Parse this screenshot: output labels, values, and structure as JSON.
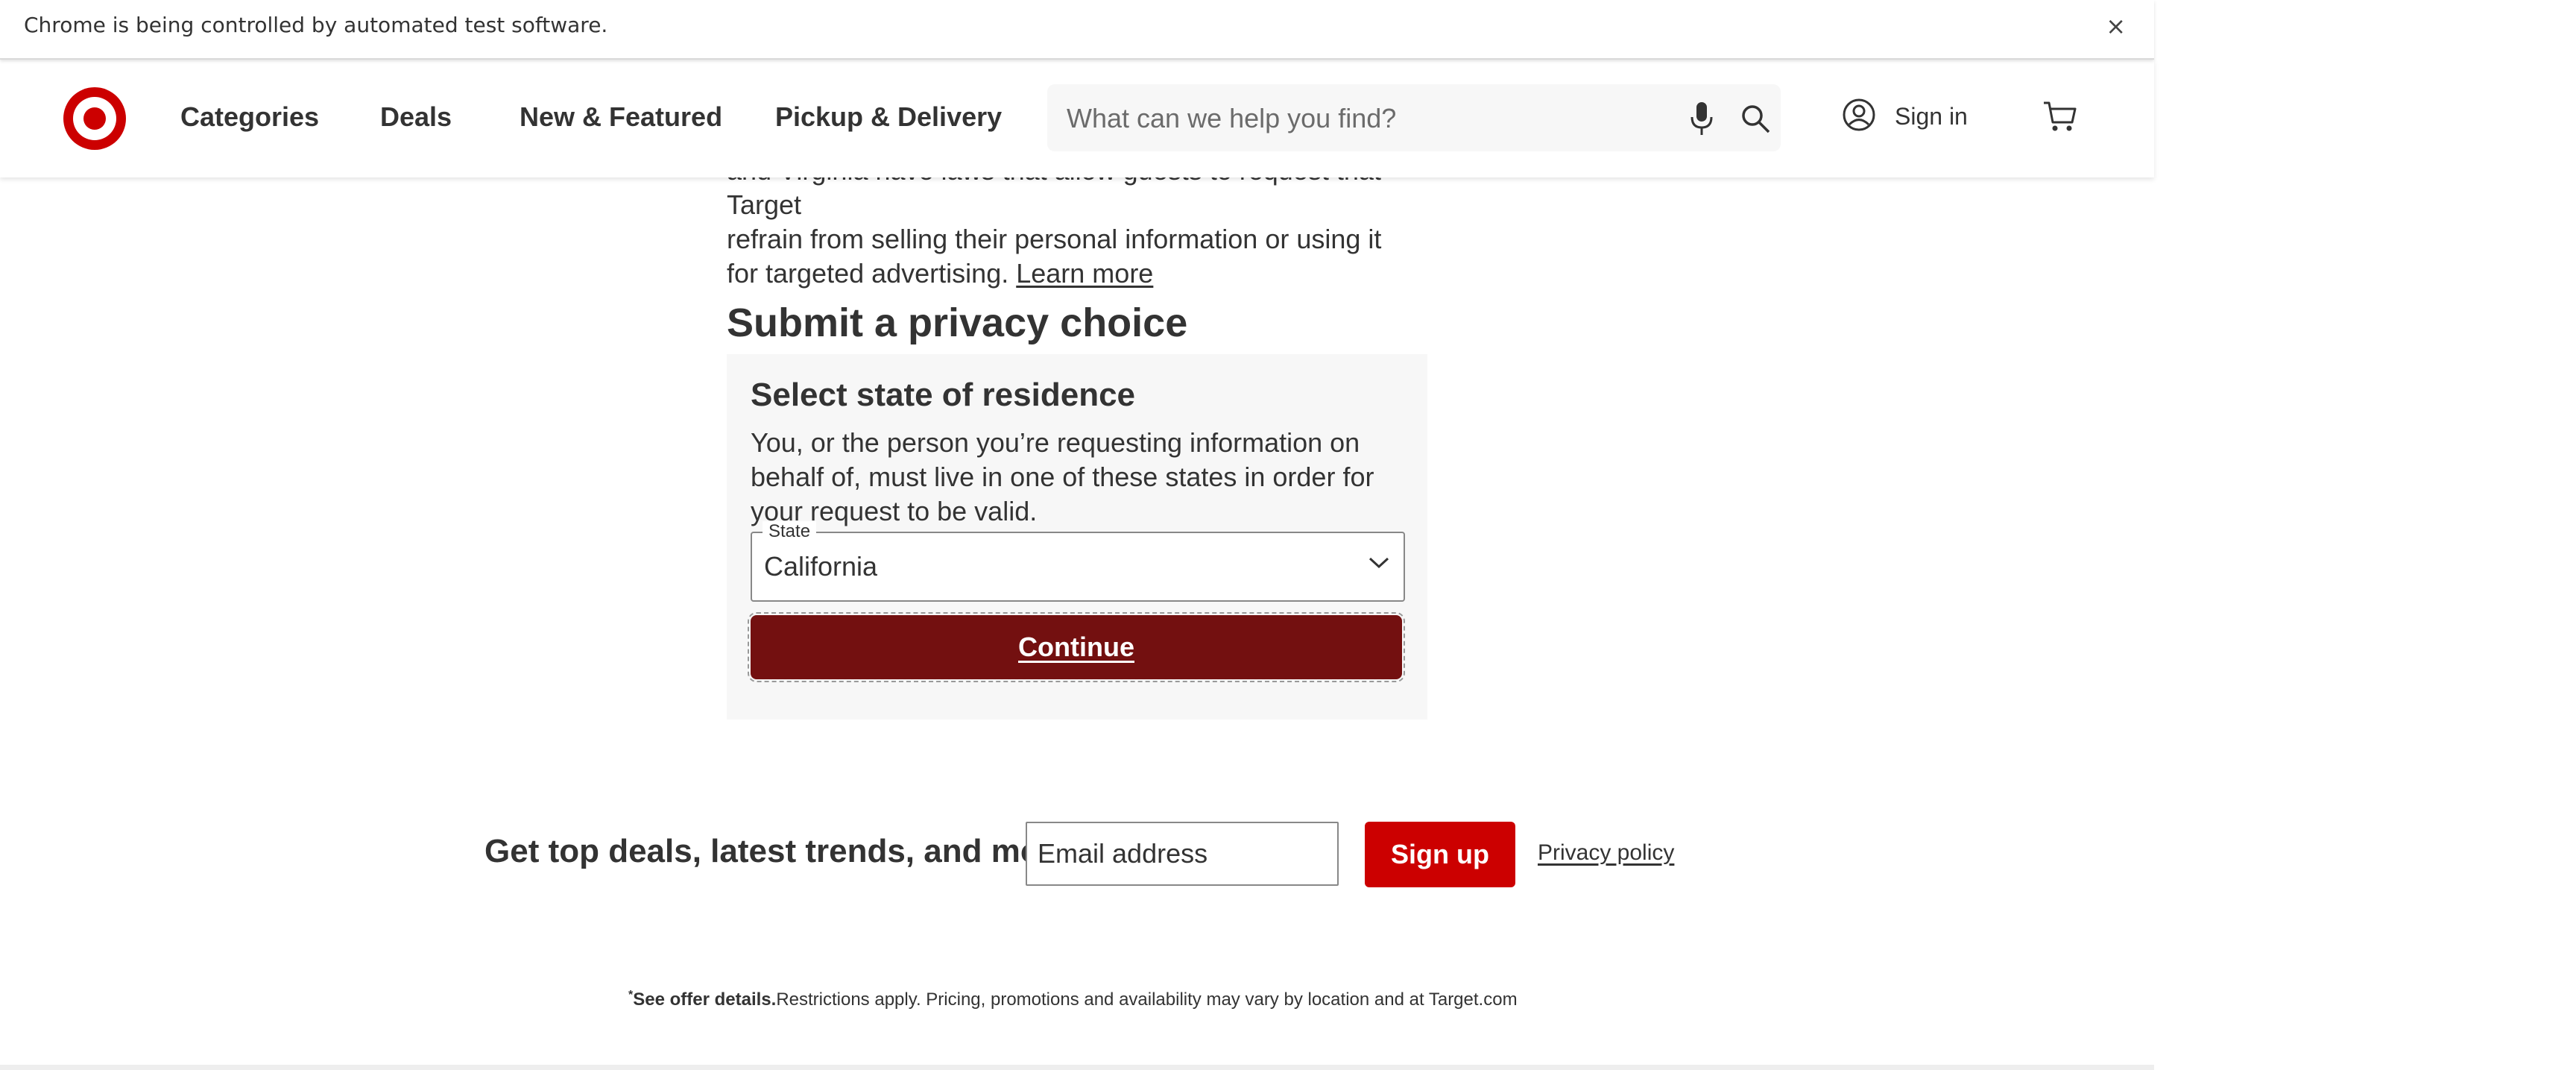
{
  "infobar": {
    "message": "Chrome is being controlled by automated test software.",
    "close_glyph": "×"
  },
  "header": {
    "nav": [
      "Categories",
      "Deals",
      "New & Featured",
      "Pickup & Delivery"
    ],
    "search_placeholder": "What can we help you find?",
    "account_label": "Sign in",
    "brand_color": "#cc0000"
  },
  "intro": {
    "partial_line": "and Virginia have laws that allow guests to request that Target",
    "text": "refrain from selling their personal information or using it for targeted advertising.",
    "learn_more": "Learn more"
  },
  "privacy": {
    "heading": "Submit a privacy choice",
    "panel_title": "Select state of residence",
    "panel_description": "You, or the person you’re requesting information on behalf of, must live in one of these states in order for your request to be valid.",
    "state_label": "State",
    "state_value": "California",
    "continue_label": "Continue",
    "continue_color": "#731010"
  },
  "newsletter": {
    "label": "Get top deals, latest trends, and more.",
    "email_placeholder": "Email address",
    "signup_label": "Sign up",
    "privacy_link": "Privacy policy"
  },
  "footer": {
    "sup": "*",
    "bold": "See offer details.",
    "rest": "Restrictions apply. Pricing, promotions and availability may vary by location and at Target.com"
  }
}
